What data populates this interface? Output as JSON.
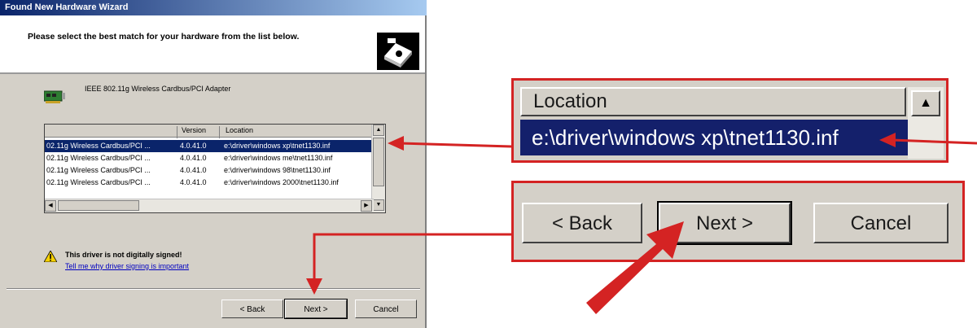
{
  "window": {
    "title": "Found New Hardware Wizard"
  },
  "header": {
    "instruction": "Please select the best match for your hardware from the list below.",
    "icon": "hardware-wizard-icon"
  },
  "device": {
    "name": "IEEE 802.11g Wireless Cardbus/PCI Adapter",
    "icon": "network-card-icon"
  },
  "driver_list": {
    "columns": [
      "",
      "Version",
      "Location"
    ],
    "rows": [
      {
        "description": "02.11g Wireless Cardbus/PCI ...",
        "version": "4.0.41.0",
        "location": "e:\\driver\\windows xp\\tnet1130.inf",
        "selected": true
      },
      {
        "description": "02.11g Wireless Cardbus/PCI ...",
        "version": "4.0.41.0",
        "location": "e:\\driver\\windows me\\tnet1130.inf",
        "selected": false
      },
      {
        "description": "02.11g Wireless Cardbus/PCI ...",
        "version": "4.0.41.0",
        "location": "e:\\driver\\windows 98\\tnet1130.inf",
        "selected": false
      },
      {
        "description": "02.11g Wireless Cardbus/PCI ...",
        "version": "4.0.41.0",
        "location": "e:\\driver\\windows 2000\\tnet1130.inf",
        "selected": false
      }
    ]
  },
  "warning": {
    "text": "This driver is not digitally signed!",
    "link": "Tell me why driver signing is important",
    "icon": "warning-icon"
  },
  "buttons": {
    "back": "< Back",
    "next": "Next >",
    "cancel": "Cancel"
  },
  "zoom_location": {
    "header": "Location",
    "value": "e:\\driver\\windows xp\\tnet1130.inf"
  },
  "zoom_buttons": {
    "back": "< Back",
    "next": "Next >",
    "cancel": "Cancel"
  },
  "colors": {
    "annotation": "#d42323",
    "selection": "#0a246a",
    "title_bar": "#0a246a"
  }
}
